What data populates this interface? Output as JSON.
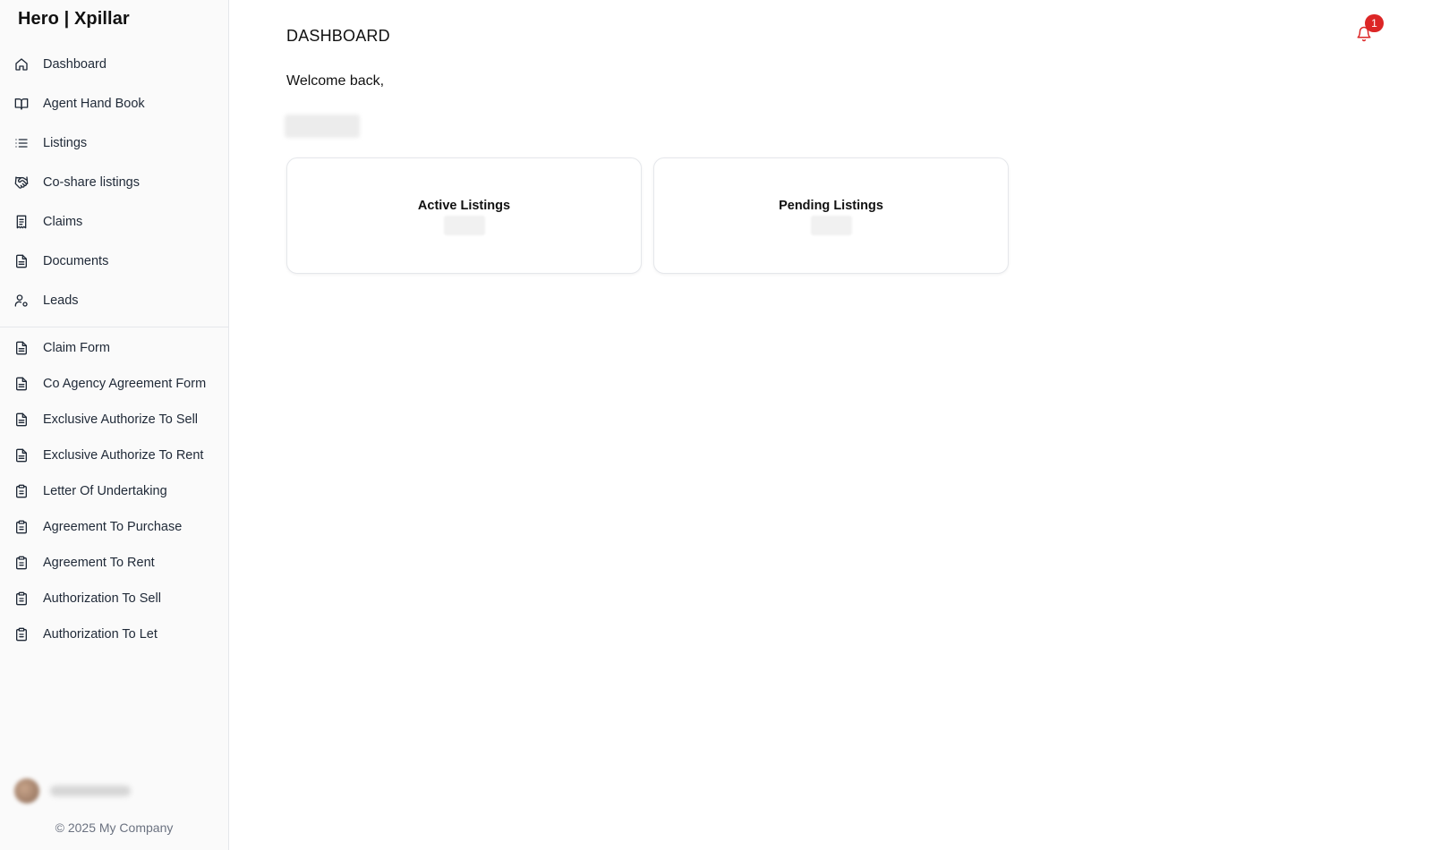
{
  "brand": "Hero | Xpillar",
  "sidebar": {
    "primary": [
      {
        "label": "Dashboard",
        "icon": "home-icon"
      },
      {
        "label": "Agent Hand Book",
        "icon": "book-open-icon"
      },
      {
        "label": "Listings",
        "icon": "list-icon"
      },
      {
        "label": "Co-share listings",
        "icon": "handshake-icon"
      },
      {
        "label": "Claims",
        "icon": "receipt-icon"
      },
      {
        "label": "Documents",
        "icon": "file-text-icon"
      },
      {
        "label": "Leads",
        "icon": "user-cog-icon"
      }
    ],
    "forms": [
      {
        "label": "Claim Form",
        "icon": "file-text-icon"
      },
      {
        "label": "Co Agency Agreement Form",
        "icon": "file-text-icon"
      },
      {
        "label": "Exclusive Authorize To Sell",
        "icon": "file-text-icon"
      },
      {
        "label": "Exclusive Authorize To Rent",
        "icon": "file-text-icon"
      },
      {
        "label": "Letter Of Undertaking",
        "icon": "clipboard-icon"
      },
      {
        "label": "Agreement To Purchase",
        "icon": "clipboard-icon"
      },
      {
        "label": "Agreement To Rent",
        "icon": "clipboard-icon"
      },
      {
        "label": "Authorization To Sell",
        "icon": "clipboard-icon"
      },
      {
        "label": "Authorization To Let",
        "icon": "clipboard-icon"
      }
    ],
    "copyright": "© 2025 My Company"
  },
  "header": {
    "title": "DASHBOARD",
    "notification_count": "1",
    "bell_color": "#dc2626"
  },
  "main": {
    "welcome": "Welcome back,",
    "cards": [
      {
        "title": "Active Listings"
      },
      {
        "title": "Pending Listings"
      }
    ]
  }
}
